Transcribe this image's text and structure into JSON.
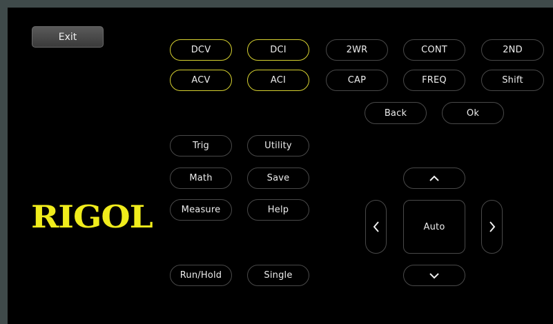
{
  "exit_label": "Exit",
  "logo_text": "RIGOL",
  "row1": [
    "DCV",
    "DCI",
    "2WR",
    "CONT",
    "2ND"
  ],
  "row2": [
    "ACV",
    "ACI",
    "CAP",
    "FREQ",
    "Shift"
  ],
  "row3": [
    "Back",
    "Ok"
  ],
  "left_buttons": {
    "trig": "Trig",
    "utility": "Utility",
    "math": "Math",
    "save": "Save",
    "measure": "Measure",
    "help": "Help",
    "run_hold": "Run/Hold",
    "single": "Single"
  },
  "nav": {
    "auto_label": "Auto",
    "up_icon": "chevron-up-icon",
    "down_icon": "chevron-down-icon",
    "left_icon": "chevron-left-icon",
    "right_icon": "chevron-right-icon"
  },
  "colors": {
    "active_border": "#d9d431",
    "logo": "#f0ec1c",
    "background": "#000000"
  }
}
